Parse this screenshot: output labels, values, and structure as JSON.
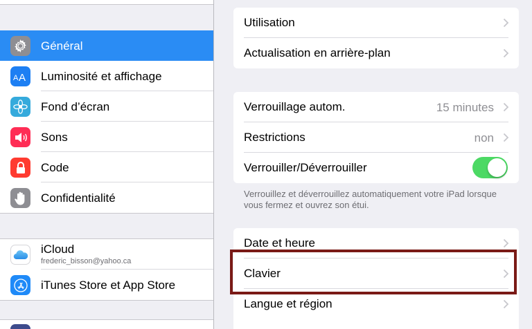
{
  "sidebar": {
    "items": [
      {
        "label": "Général",
        "icon": "gear-icon",
        "color": "#8e8e93",
        "selected": true
      },
      {
        "label": "Luminosité et affichage",
        "icon": "text-size-icon",
        "color": "#1d7ff3"
      },
      {
        "label": "Fond d’écran",
        "icon": "flower-icon",
        "color": "#35aadc"
      },
      {
        "label": "Sons",
        "icon": "speaker-icon",
        "color": "#ff2d55"
      },
      {
        "label": "Code",
        "icon": "lock-icon",
        "color": "#ff3b30"
      },
      {
        "label": "Confidentialité",
        "icon": "hand-icon",
        "color": "#8e8e93"
      }
    ],
    "accounts": [
      {
        "label": "iCloud",
        "sublabel": "frederic_bisson@yahoo.ca",
        "icon": "icloud-icon"
      },
      {
        "label": "iTunes Store et App Store",
        "icon": "app-store-icon",
        "color": "#1f8af8"
      }
    ]
  },
  "detail": {
    "group1": [
      {
        "label": "Utilisation"
      },
      {
        "label": "Actualisation en arrière-plan"
      }
    ],
    "group2": [
      {
        "label": "Verrouillage autom.",
        "value": "15 minutes"
      },
      {
        "label": "Restrictions",
        "value": "non"
      },
      {
        "label": "Verrouiller/Déverrouiller",
        "toggle": true
      }
    ],
    "footnote": "Verrouillez et déverrouillez automatiquement votre iPad lorsque vous fermez et ouvrez son étui.",
    "group3": [
      {
        "label": "Date et heure"
      },
      {
        "label": "Clavier",
        "highlighted": true
      },
      {
        "label": "Langue et région"
      }
    ]
  },
  "colors": {
    "selected": "#2a8cf4",
    "toggle_on": "#4cd964",
    "highlight_border": "#7a1a16",
    "background": "#efeff4"
  }
}
